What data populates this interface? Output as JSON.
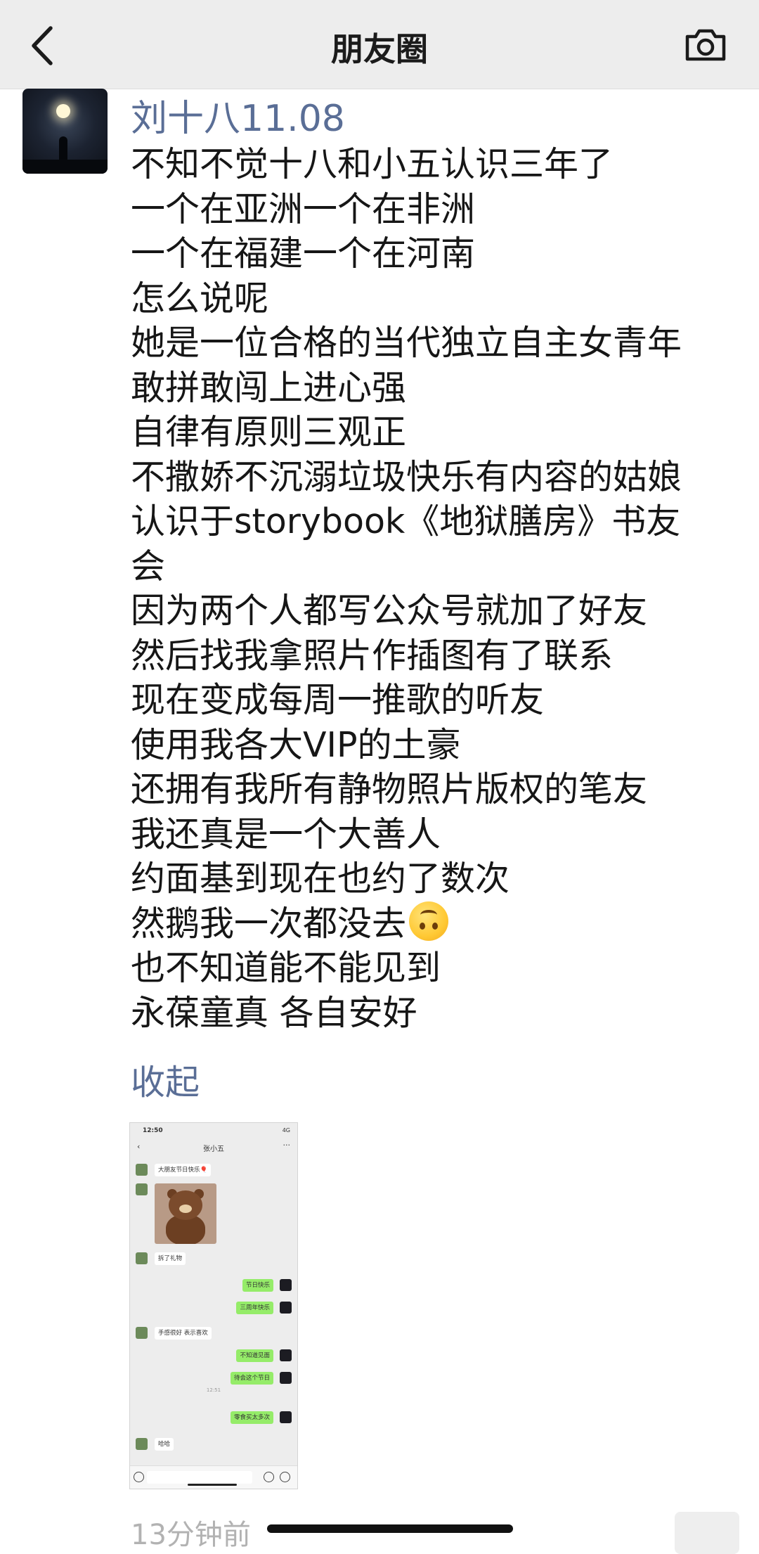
{
  "nav": {
    "title": "朋友圈",
    "back_icon": "chevron-left-icon",
    "camera_icon": "camera-icon"
  },
  "post": {
    "author": "刘十八11.08",
    "lines": [
      "不知不觉十八和小五认识三年了",
      "一个在亚洲一个在非洲",
      "一个在福建一个在河南",
      "怎么说呢",
      "她是一位合格的当代独立自主女青年",
      "敢拼敢闯上进心强",
      "自律有原则三观正",
      "不撒娇不沉溺垃圾快乐有内容的姑娘",
      "认识于storybook《地狱膳房》书友",
      "会",
      "因为两个人都写公众号就加了好友",
      "然后找我拿照片作插图有了联系",
      "现在变成每周一推歌的听友",
      "使用我各大VIP的土豪",
      "还拥有我所有静物照片版权的笔友",
      "我还真是一个大善人",
      "约面基到现在也约了数次",
      "然鹅我一次都没去",
      "也不知道能不能见到",
      "永葆童真  各自安好"
    ],
    "emoji": "upside-down-face-emoji",
    "collapse_label": "收起",
    "time_ago": "13分钟前"
  },
  "shot": {
    "time": "12:50",
    "signal": "4G",
    "contact": "张小五",
    "messages": [
      {
        "from": "other",
        "text": "大朋友节日快乐🎈"
      },
      {
        "from": "other",
        "text": "拆了礼物"
      },
      {
        "from": "me",
        "text": "节日快乐"
      },
      {
        "from": "me",
        "text": "三周年快乐"
      },
      {
        "from": "other",
        "text": "手感很好 表示喜欢"
      },
      {
        "from": "me",
        "text": "不知道见面"
      },
      {
        "from": "me",
        "text": "待会这个节日"
      },
      {
        "from": "me",
        "text": "零食买太多次"
      },
      {
        "from": "other",
        "text": "哈哈"
      }
    ],
    "timestamp": "12:51"
  },
  "colors": {
    "nav_bg": "#ededed",
    "link_blue": "#5a6e96",
    "chat_green": "#95ec69",
    "chat_bg": "#ededed"
  }
}
